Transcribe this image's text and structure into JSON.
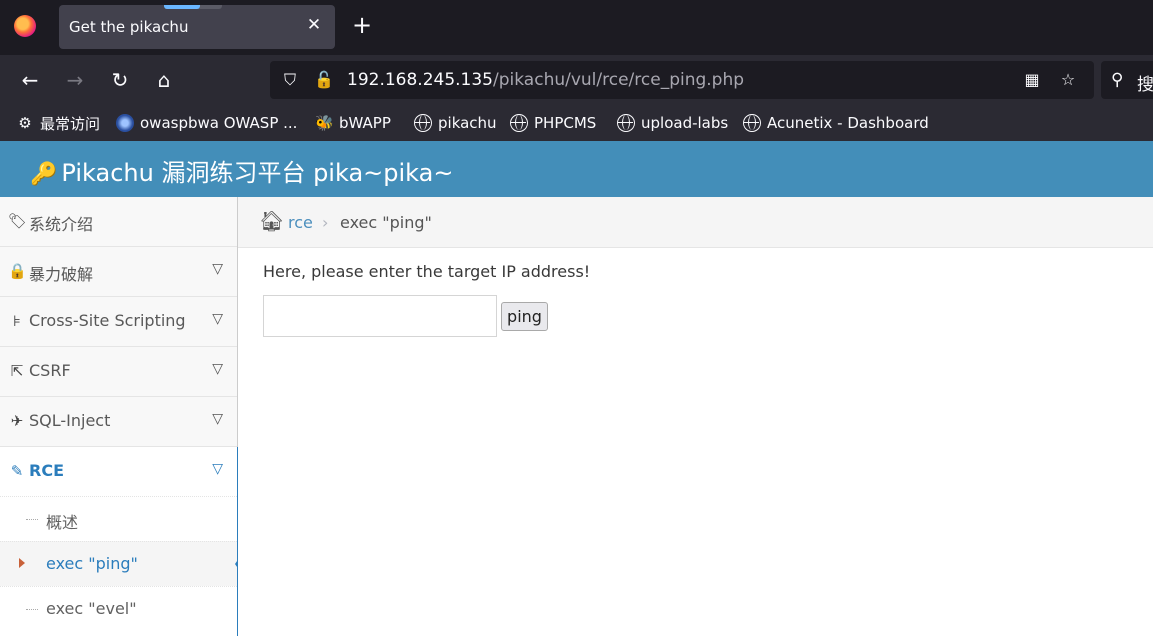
{
  "browser": {
    "tab_title": "Get the pikachu",
    "tab_close": "✕",
    "new_tab": "+",
    "url_host": "192.168.245.135",
    "url_path": "/pikachu/vul/rce/rce_ping.php",
    "search_partial": "搜",
    "bookmarks": [
      {
        "label": "最常访问",
        "icon": "gear-icon"
      },
      {
        "label": "owaspbwa OWASP ...",
        "icon": "owasp-icon"
      },
      {
        "label": "bWAPP",
        "icon": "bee-icon"
      },
      {
        "label": "pikachu",
        "icon": "globe-icon"
      },
      {
        "label": "PHPCMS",
        "icon": "globe-icon"
      },
      {
        "label": "upload-labs",
        "icon": "globe-icon"
      },
      {
        "label": "Acunetix - Dashboard",
        "icon": "globe-icon"
      }
    ]
  },
  "site": {
    "title": "Pikachu 漏洞练习平台 pika~pika~",
    "header_color": "#438eb9",
    "accent_color": "#2b7dbc"
  },
  "sidebar": {
    "items": [
      {
        "label": "系统介绍",
        "icon": "tags-icon",
        "expandable": false
      },
      {
        "label": "暴力破解",
        "icon": "lock-icon",
        "expandable": true
      },
      {
        "label": "Cross-Site Scripting",
        "icon": "sitemap-icon",
        "expandable": true
      },
      {
        "label": "CSRF",
        "icon": "share-icon",
        "expandable": true
      },
      {
        "label": "SQL-Inject",
        "icon": "fighter-jet-icon",
        "expandable": true
      },
      {
        "label": "RCE",
        "icon": "pencil-icon",
        "expandable": true,
        "active": true
      }
    ],
    "rce_submenu": [
      {
        "label": "概述"
      },
      {
        "label": "exec \"ping\"",
        "active": true
      },
      {
        "label": "exec \"evel\""
      }
    ]
  },
  "breadcrumb": {
    "link": "rce",
    "separator": "›",
    "current": "exec \"ping\""
  },
  "main": {
    "prompt": "Here, please enter the target IP address!",
    "ip_value": "",
    "ping_label": "ping"
  }
}
